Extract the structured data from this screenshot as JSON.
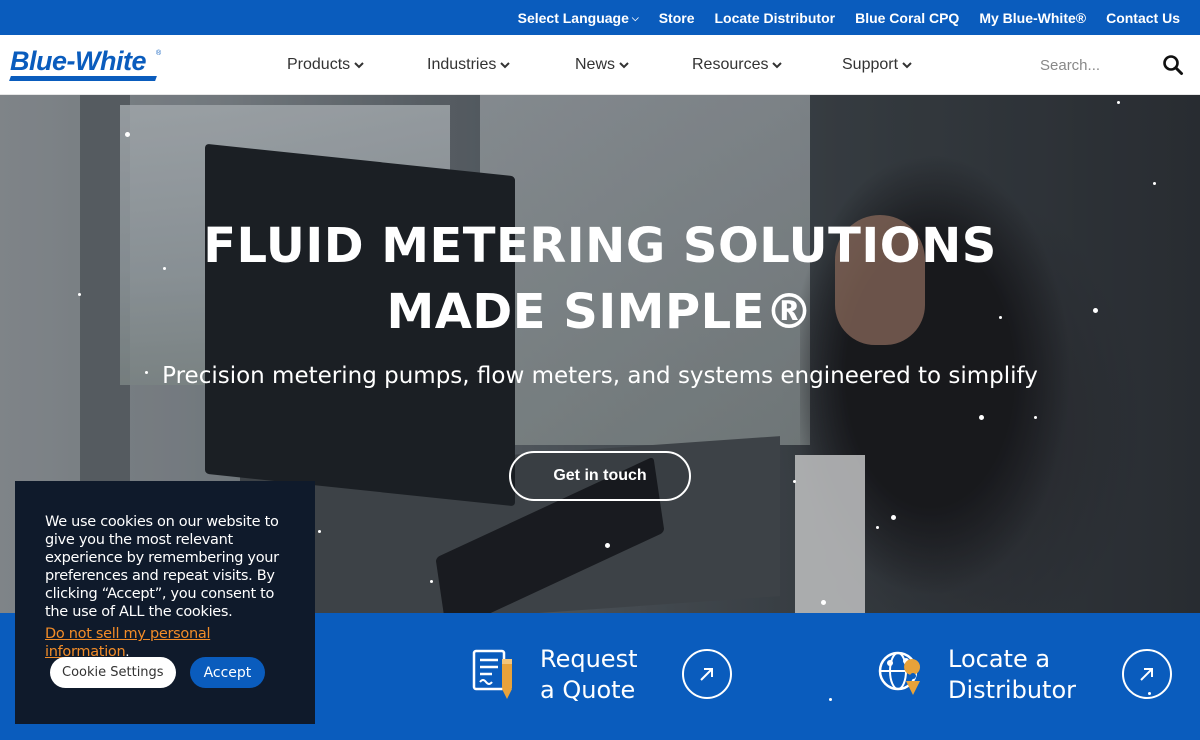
{
  "topbar": {
    "links": [
      {
        "label": "Select Language",
        "icon": "chevron-down-icon"
      },
      {
        "label": "Store"
      },
      {
        "label": "Locate Distributor"
      },
      {
        "label": "Blue Coral CPQ"
      },
      {
        "label": "My Blue-White®"
      },
      {
        "label": "Contact Us"
      }
    ]
  },
  "header": {
    "logo_text": "Blue-White",
    "nav": [
      {
        "label": "Products"
      },
      {
        "label": "Industries"
      },
      {
        "label": "News"
      },
      {
        "label": "Resources"
      },
      {
        "label": "Support"
      }
    ],
    "search_placeholder": "Search...",
    "search_icon": "search-icon"
  },
  "hero": {
    "title": "FLUID METERING SOLUTIONS MADE SIMPLE®",
    "subtitle": "Precision metering pumps, flow meters, and systems engineered to simplify",
    "cta_label": "Get in touch"
  },
  "band": {
    "cards": [
      {
        "title_line1": "Request",
        "title_line2": "a Quote",
        "icon": "quote-document-icon",
        "arrow_icon": "arrow-up-right-icon"
      },
      {
        "title_line1": "Locate a",
        "title_line2": "Distributor",
        "icon": "globe-location-icon",
        "arrow_icon": "arrow-up-right-icon"
      }
    ]
  },
  "cookie": {
    "text": "We use cookies on our website to give you the most relevant experience by remembering your preferences and repeat visits. By clicking “Accept”, you consent to the use of ALL the cookies.",
    "link_text": "Do not sell my personal information",
    "settings_label": "Cookie Settings",
    "accept_label": "Accept"
  },
  "colors": {
    "brand_blue": "#0a5cbd",
    "cookie_bg": "#0f1a2b",
    "link_orange": "#f28c28",
    "icon_gold": "#e8a23a"
  }
}
